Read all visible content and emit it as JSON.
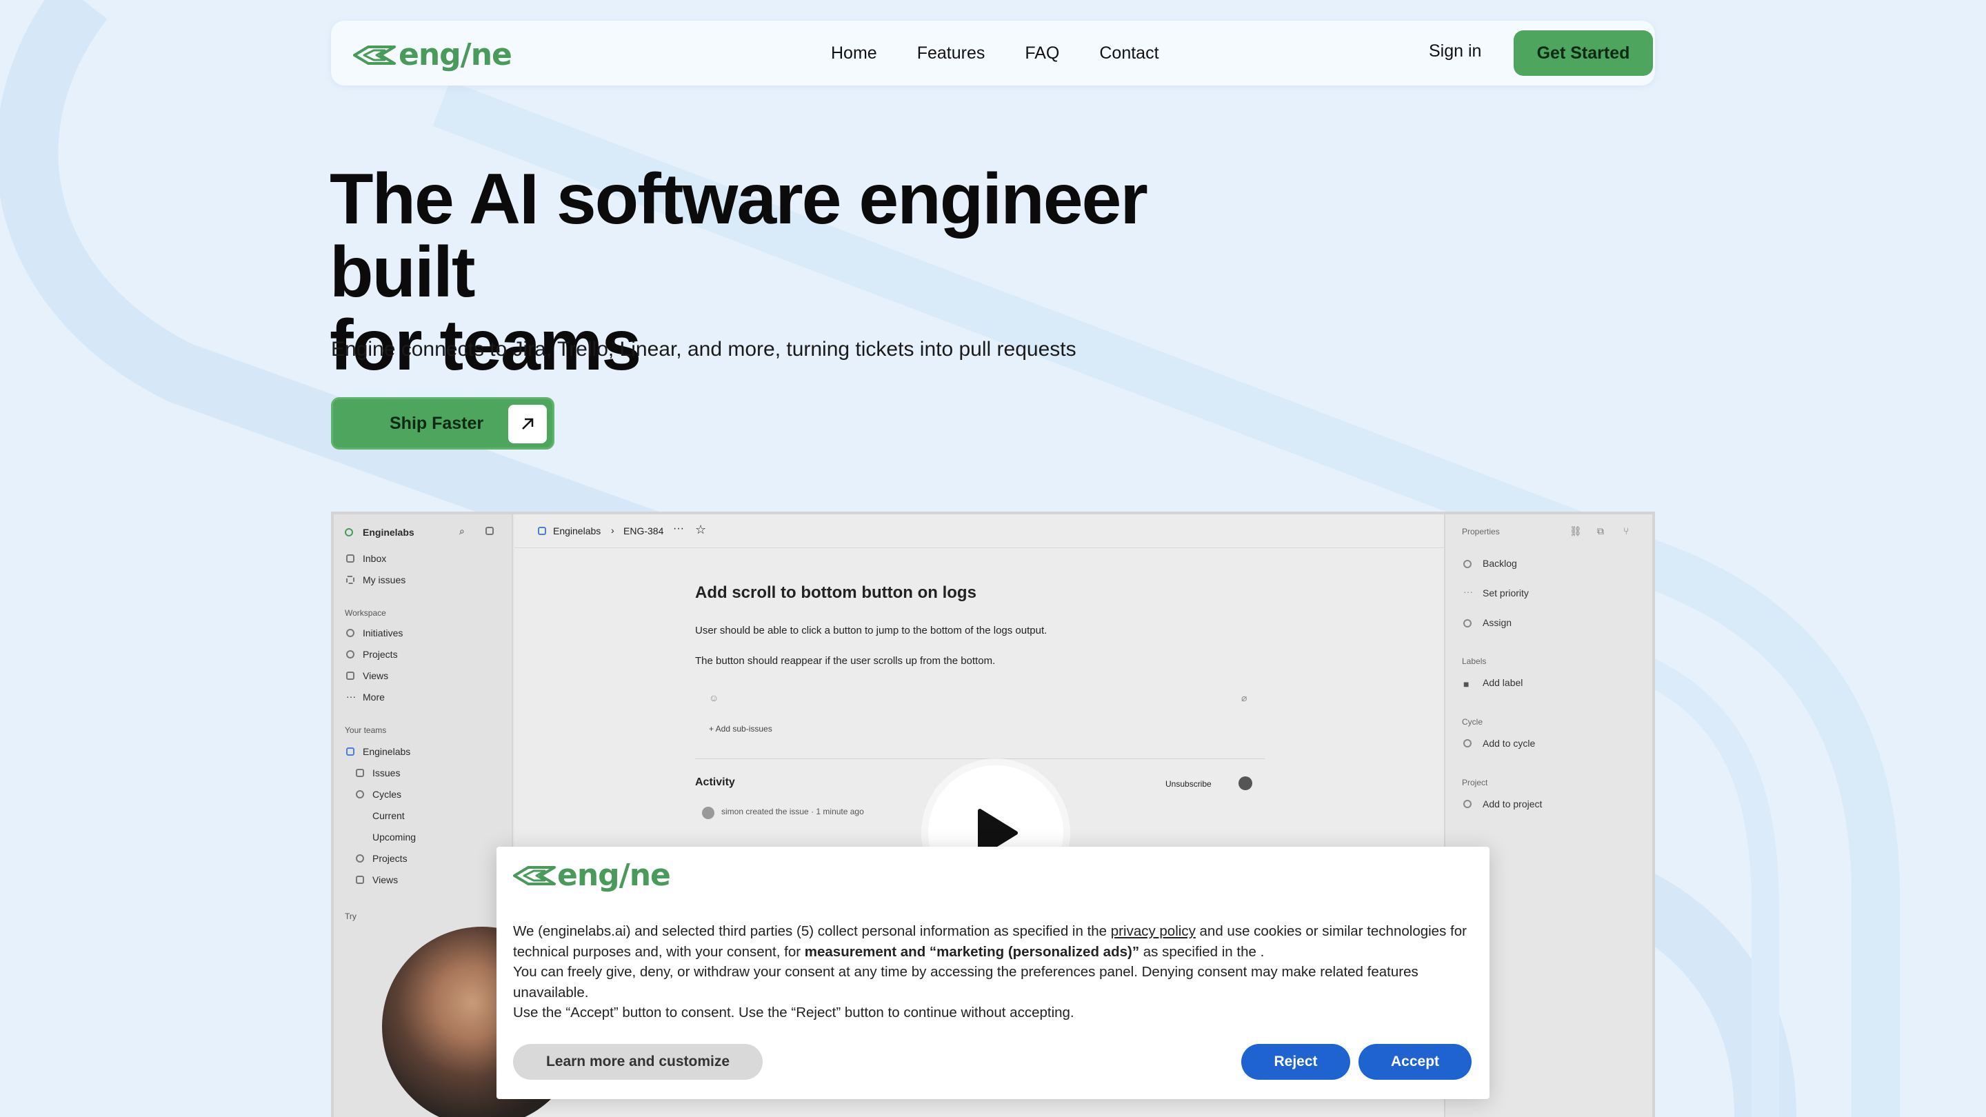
{
  "brand": {
    "logo_text": "eng/ne",
    "accent": "#4ea55d",
    "blue": "#1e63d0"
  },
  "nav": {
    "links": [
      "Home",
      "Features",
      "FAQ",
      "Contact"
    ],
    "sign_in": "Sign in",
    "get_started": "Get Started"
  },
  "hero": {
    "title_line1": "The AI software engineer built",
    "title_line2": "for teams",
    "subtitle": "Engine connects to Jira, Trello, Linear, and more, turning tickets into pull requests",
    "cta_label": "Ship Faster",
    "cta_icon": "arrow-up-right-icon"
  },
  "preview": {
    "sidebar": {
      "workspace_name": "Enginelabs",
      "items_top": [
        "Inbox",
        "My issues"
      ],
      "workspace_header": "Workspace",
      "workspace_items": [
        "Initiatives",
        "Projects",
        "Views",
        "More"
      ],
      "teams_header": "Your teams",
      "team_name": "Enginelabs",
      "team_items": [
        "Issues",
        "Cycles"
      ],
      "cycle_items": [
        "Current",
        "Upcoming"
      ],
      "team_items_bottom": [
        "Projects",
        "Views"
      ],
      "try_label": "Try"
    },
    "breadcrumb": {
      "workspace": "Enginelabs",
      "sep": "›",
      "issue": "ENG-384"
    },
    "issue": {
      "title": "Add scroll to bottom button on logs",
      "desc1": "User should be able to click a button to jump to the bottom of the logs output.",
      "desc2": "The button should reappear if the user scrolls up from the bottom.",
      "add_sub": "+ Add sub-issues",
      "activity": "Activity",
      "unsubscribe": "Unsubscribe",
      "activity_entry": "simon created the issue · 1 minute ago"
    },
    "properties": {
      "header": "Properties",
      "status": "Backlog",
      "priority": "Set priority",
      "assign": "Assign",
      "labels_header": "Labels",
      "add_label": "Add label",
      "cycle_header": "Cycle",
      "add_cycle": "Add to cycle",
      "project_header": "Project",
      "add_project": "Add to project"
    }
  },
  "cookie": {
    "logo_text": "eng/ne",
    "p1_a": "We (enginelabs.ai) and selected third parties (5) collect personal information as specified in the ",
    "privacy_link": "privacy policy",
    "p1_b": " and use cookies or similar technologies for technical purposes and, with your consent, for ",
    "p1_bold": "measurement and “marketing (personalized ads)”",
    "p1_c": " as specified in the .",
    "p2": "You can freely give, deny, or withdraw your consent at any time by accessing the preferences panel. Denying consent may make related features unavailable.",
    "p3": "Use the “Accept” button to consent. Use the “Reject” button to continue without accepting.",
    "learn_more": "Learn more and customize",
    "reject": "Reject",
    "accept": "Accept"
  }
}
